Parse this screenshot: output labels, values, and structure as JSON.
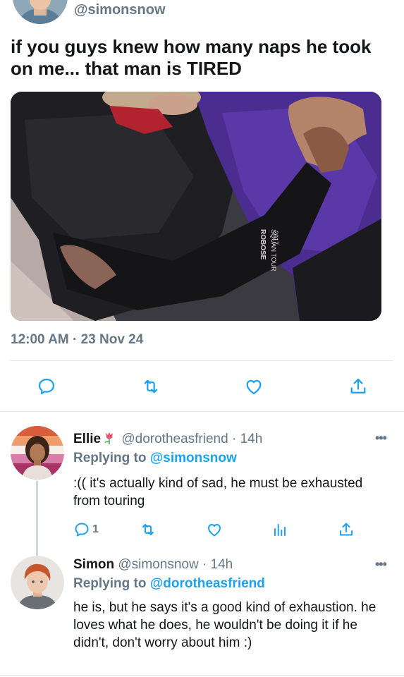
{
  "main_tweet": {
    "handle": "@simonsnow",
    "text": "if you guys knew how many naps he took on me... that man is TIRED",
    "photo_sleeve_text": "ROBOSE\nSQUAN TOUR\n2017",
    "timestamp": "12:00 AM · 23 Nov 24"
  },
  "replies": [
    {
      "name": "Ellie",
      "handle": "@dorotheasfriend · 14h",
      "replying_prefix": "Replying to",
      "replying_to": "@simonsnow",
      "text": ":(( it's actually kind of sad, he must be exhausted from touring",
      "reply_count": "1",
      "more": "•••"
    },
    {
      "name": "Simon",
      "handle": "@simonsnow · 14h",
      "replying_prefix": "Replying to",
      "replying_to": "@dorotheasfriend",
      "text": "he is, but he says it's a good kind of exhaustion. he loves what he does, he wouldn't be doing it if he didn't, don't worry about him :)",
      "more": "•••"
    }
  ],
  "colors": {
    "accent": "#1da1f2",
    "secondary_text": "#657786",
    "divider": "#e1e8ed"
  },
  "icons": [
    "reply-icon",
    "retweet-icon",
    "like-icon",
    "share-icon",
    "analytics-icon",
    "more-icon",
    "flower-emoji-icon"
  ]
}
